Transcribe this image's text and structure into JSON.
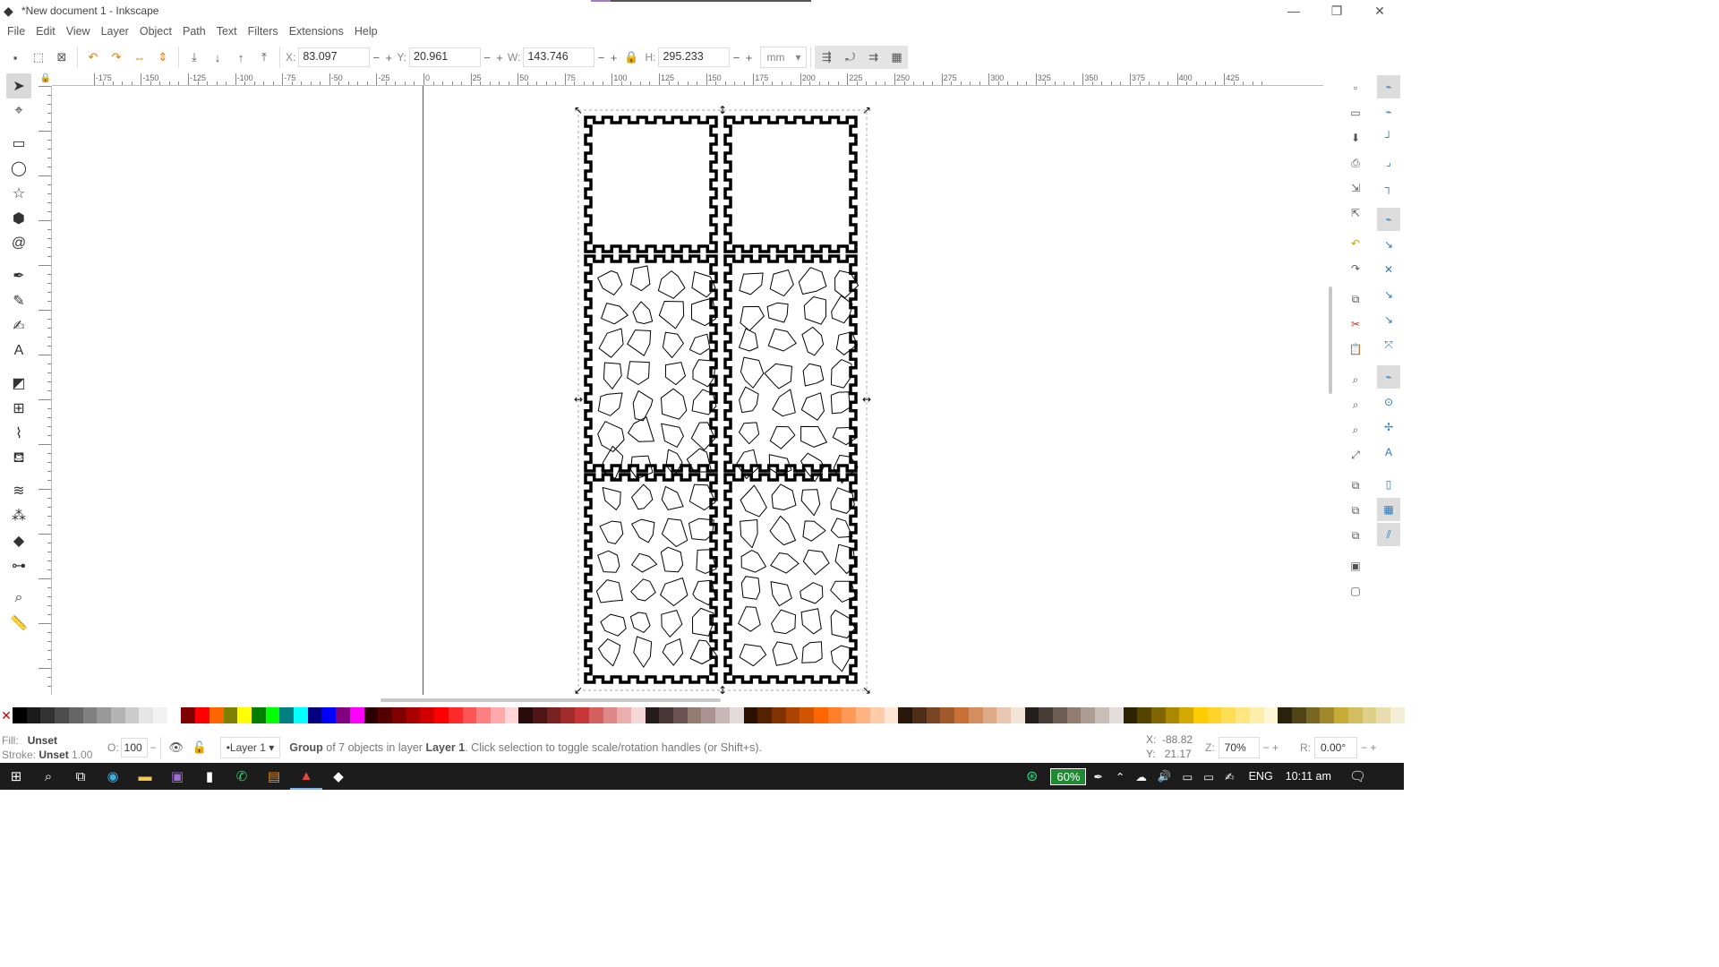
{
  "window": {
    "title": "*New document 1 - Inkscape",
    "min": "—",
    "restore": "❐",
    "close": "✕"
  },
  "menu": [
    "File",
    "Edit",
    "View",
    "Layer",
    "Object",
    "Path",
    "Text",
    "Filters",
    "Extensions",
    "Help"
  ],
  "controls": {
    "x_label": "X:",
    "x_value": "83.097",
    "y_label": "Y:",
    "y_value": "20.961",
    "w_label": "W:",
    "w_value": "143.746",
    "h_label": "H:",
    "h_value": "295.233",
    "unit": "mm",
    "minus": "−",
    "plus": "+"
  },
  "ruler_labels": [
    "-175",
    "-150",
    "-125",
    "-100",
    "-75",
    "-50",
    "-25",
    "0",
    "25",
    "50",
    "75",
    "100",
    "125",
    "150",
    "175",
    "200",
    "225",
    "250",
    "275",
    "300",
    "325",
    "350",
    "375",
    "400",
    "425"
  ],
  "tools": [
    {
      "name": "selector-tool",
      "glyph": "➤",
      "active": true
    },
    {
      "name": "node-tool",
      "glyph": "⌖"
    },
    {
      "name": "rectangle-tool",
      "glyph": "▭"
    },
    {
      "name": "ellipse-tool",
      "glyph": "◯"
    },
    {
      "name": "star-tool",
      "glyph": "☆"
    },
    {
      "name": "3dbox-tool",
      "glyph": "⬢"
    },
    {
      "name": "spiral-tool",
      "glyph": "@"
    },
    {
      "name": "pen-tool",
      "glyph": "✒"
    },
    {
      "name": "pencil-tool",
      "glyph": "✎"
    },
    {
      "name": "calligraphy-tool",
      "glyph": "✍"
    },
    {
      "name": "text-tool",
      "glyph": "A"
    },
    {
      "name": "gradient-tool",
      "glyph": "◩"
    },
    {
      "name": "mesh-tool",
      "glyph": "⊞"
    },
    {
      "name": "dropper-tool",
      "glyph": "⌇"
    },
    {
      "name": "paint-bucket-tool",
      "glyph": "⛾"
    },
    {
      "name": "tweak-tool",
      "glyph": "≋"
    },
    {
      "name": "spray-tool",
      "glyph": "⁂"
    },
    {
      "name": "eraser-tool",
      "glyph": "◆"
    },
    {
      "name": "connector-tool",
      "glyph": "⊶"
    },
    {
      "name": "zoom-tool",
      "glyph": "⌕"
    },
    {
      "name": "measure-tool",
      "glyph": "📏"
    }
  ],
  "palette": [
    "#000000",
    "#1a1a1a",
    "#333333",
    "#4d4d4d",
    "#666666",
    "#808080",
    "#999999",
    "#b3b3b3",
    "#cccccc",
    "#e6e6e6",
    "#f2f2f2",
    "#ffffff",
    "#800000",
    "#ff0000",
    "#ff6600",
    "#808000",
    "#ffff00",
    "#008000",
    "#00ff00",
    "#008080",
    "#00ffff",
    "#000080",
    "#0000ff",
    "#800080",
    "#ff00ff",
    "#2b0000",
    "#550000",
    "#800000",
    "#aa0000",
    "#d40000",
    "#ff0000",
    "#ff2a2a",
    "#ff5555",
    "#ff8080",
    "#ffaaaa",
    "#ffd5d5",
    "#280b0b",
    "#501616",
    "#782121",
    "#a02c2c",
    "#c83737",
    "#d35f5f",
    "#de8787",
    "#e9afaf",
    "#f4d7d7",
    "#241c1c",
    "#483737",
    "#6c5353",
    "#917c6f",
    "#ac9393",
    "#c8b7b7",
    "#e3dbdb",
    "#2b1100",
    "#552200",
    "#803300",
    "#aa4400",
    "#d45500",
    "#ff6600",
    "#ff7f2a",
    "#ff9955",
    "#ffb380",
    "#ffccaa",
    "#ffe6d5",
    "#28170b",
    "#502d16",
    "#784421",
    "#a05a2c",
    "#c87137",
    "#d38d5f",
    "#deaa87",
    "#e9c6af",
    "#f4e3d7",
    "#241f1c",
    "#483e37",
    "#6c5d53",
    "#917c6f",
    "#ac9d93",
    "#c8beb7",
    "#e3dedb",
    "#2b2200",
    "#554400",
    "#806600",
    "#aa8800",
    "#d4aa00",
    "#ffcc00",
    "#ffd42a",
    "#ffdd55",
    "#ffe680",
    "#ffeeaa",
    "#fff6d5",
    "#28220b",
    "#504416",
    "#786721",
    "#a0892c",
    "#c8ab37",
    "#d4bd5f",
    "#ded087",
    "#e9ddaf",
    "#f4eed7"
  ],
  "status": {
    "fill_label": "Fill:",
    "fill_value": "Unset",
    "stroke_label": "Stroke:",
    "stroke_value": "Unset",
    "stroke_width": "1.00",
    "opacity_label": "O:",
    "opacity_value": "100",
    "layer": "•Layer 1",
    "message_prefix": "Group",
    "message_middle": " of 7 objects in layer ",
    "message_layer": "Layer 1",
    "message_suffix": ". Click selection to toggle scale/rotation handles (or Shift+s).",
    "cx_label": "X:",
    "cx_value": "-88.82",
    "cy_label": "Y:",
    "cy_value": "21.17",
    "zoom_label": "Z:",
    "zoom_value": "70%",
    "rot_label": "R:",
    "rot_value": "0.00°"
  },
  "taskbar": {
    "battery": "60%",
    "lang": "ENG",
    "time": "10:11 am"
  }
}
